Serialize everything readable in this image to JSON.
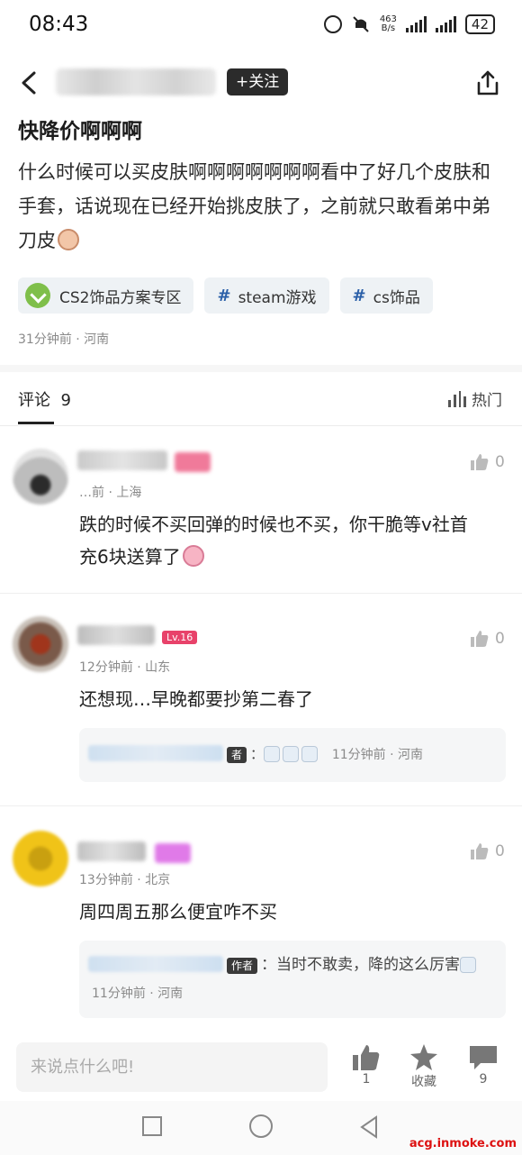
{
  "status_bar": {
    "time": "08:43",
    "net_speed": "463",
    "net_unit": "B/s",
    "battery": "42"
  },
  "header": {
    "follow_label": "+关注"
  },
  "post": {
    "title": "快降价啊啊啊",
    "content": "什么时候可以买皮肤啊啊啊啊啊啊啊看中了好几个皮肤和手套，话说现在已经开始挑皮肤了，之前就只敢看弟中弟刀皮",
    "tags": [
      {
        "label": "CS2饰品方案专区",
        "icon": "cs2-logo-icon"
      },
      {
        "label": "steam游戏",
        "icon": "hash-icon"
      },
      {
        "label": "cs饰品",
        "icon": "hash-icon"
      }
    ],
    "meta": "31分钟前 · 河南"
  },
  "comments_header": {
    "label": "评论",
    "count": "9",
    "sort_label": "热门"
  },
  "comments": [
    {
      "meta": "…前 · 上海",
      "text": "跌的时候不买回弹的时候也不买，你干脆等v社首充6块送算了",
      "likes": "0"
    },
    {
      "level": "Lv.16",
      "meta": "12分钟前 · 山东",
      "text": "还想现…早晚都要抄第二春了",
      "likes": "0",
      "reply": {
        "author_badge": "者",
        "text": "：",
        "time": "11分钟前 · 河南"
      }
    },
    {
      "meta": "13分钟前 · 北京",
      "text": "周四周五那么便宜咋不买",
      "likes": "0",
      "reply": {
        "author_badge": "作者",
        "text": "：当时不敢卖，降的这么厉害",
        "time": "11分钟前 · 河南"
      }
    }
  ],
  "bottom_bar": {
    "input_placeholder": "来说点什么吧!",
    "like_count": "1",
    "favorite_label": "收藏",
    "comment_count": "9"
  },
  "watermark": "acg.inmoke.com"
}
